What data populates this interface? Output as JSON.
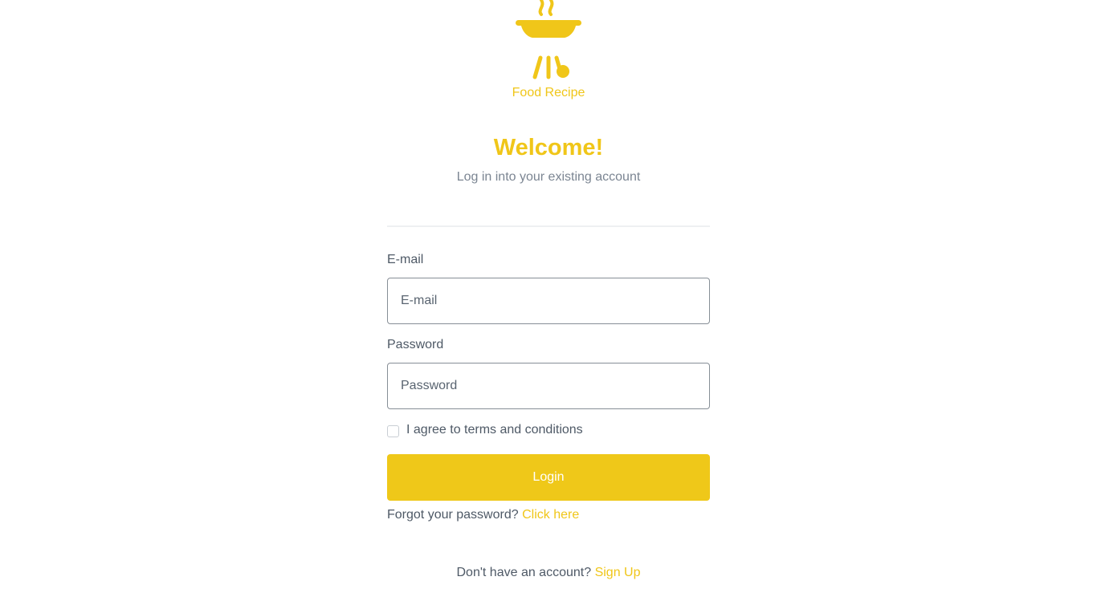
{
  "brand": {
    "name": "Food Recipe",
    "accent_color": "#f0c619",
    "logo_icon": "grill-icon"
  },
  "heading": {
    "title": "Welcome!",
    "subtitle": "Log in into your existing account"
  },
  "form": {
    "email": {
      "label": "E-mail",
      "placeholder": "E-mail",
      "value": ""
    },
    "password": {
      "label": "Password",
      "placeholder": "Password",
      "value": ""
    },
    "terms": {
      "label": "I agree to terms and conditions",
      "checked": false
    },
    "submit_label": "Login"
  },
  "forgot": {
    "text": "Forgot your password?",
    "link": "Click here"
  },
  "signup": {
    "text": "Don't have an account?",
    "link": "Sign Up"
  }
}
